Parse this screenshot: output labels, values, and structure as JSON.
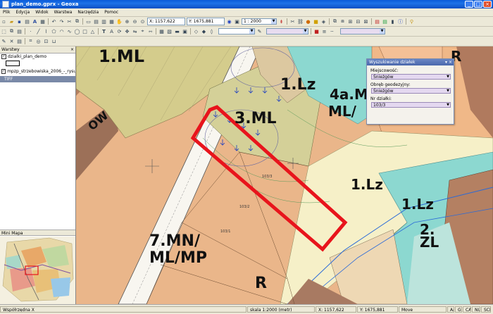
{
  "window": {
    "title": "plan_demo.gprx - Geoxa",
    "buttons": [
      "_",
      "□",
      "×"
    ]
  },
  "menu": [
    "Plik",
    "Edycja",
    "Widok",
    "Warstwa",
    "Narzędzia",
    "Pomoc"
  ],
  "toolbar": {
    "x_coord": "X: 1157,622",
    "y_coord": "Y: 1675,881",
    "scale": "1 : 2000"
  },
  "layers_panel": {
    "title": "Warstwy",
    "close": "×",
    "layers": [
      {
        "label": "dzialki_plan_demo",
        "checked": true
      },
      {
        "label": "mpzp_strzebowiska_2006_-_rysu...",
        "checked": true
      }
    ],
    "raster": "TIFF"
  },
  "minimap_panel": {
    "title": "Mini Mapa"
  },
  "map": {
    "zone_labels": [
      "1.ML",
      "1.Lz",
      "4a.M",
      "ML/",
      "3.ML",
      "1.Lz",
      "1.Lz",
      "2.",
      "ZL",
      "7.MN/",
      "ML/MP",
      "R",
      "R",
      "OW"
    ],
    "parcel_labels": [
      "103/3",
      "103/2",
      "103/1"
    ]
  },
  "search_dialog": {
    "title": "Wyszukiwanie działek",
    "header_buttons": "▾ ×",
    "fields": [
      {
        "label": "Miejscowość:",
        "value": "Śnieżgów"
      },
      {
        "label": "Obręb geodezyjny:",
        "value": "Śnieżgów"
      },
      {
        "label": "Nr działki:",
        "value": "103/3"
      }
    ]
  },
  "status": {
    "coord_label": "Współrzędna X",
    "scale": "skala 1:2000 (metr)",
    "x": "X: 1157,622",
    "y": "Y: 1675,881",
    "mode": "Move",
    "indicators": [
      "Aa",
      "G",
      "CAP",
      "NUM",
      "SCRL"
    ]
  },
  "colors": {
    "selection": "#e8141c",
    "forest": "#8ad8d0",
    "residential": "#f0b888",
    "woodland_ml": "#d8d090"
  }
}
